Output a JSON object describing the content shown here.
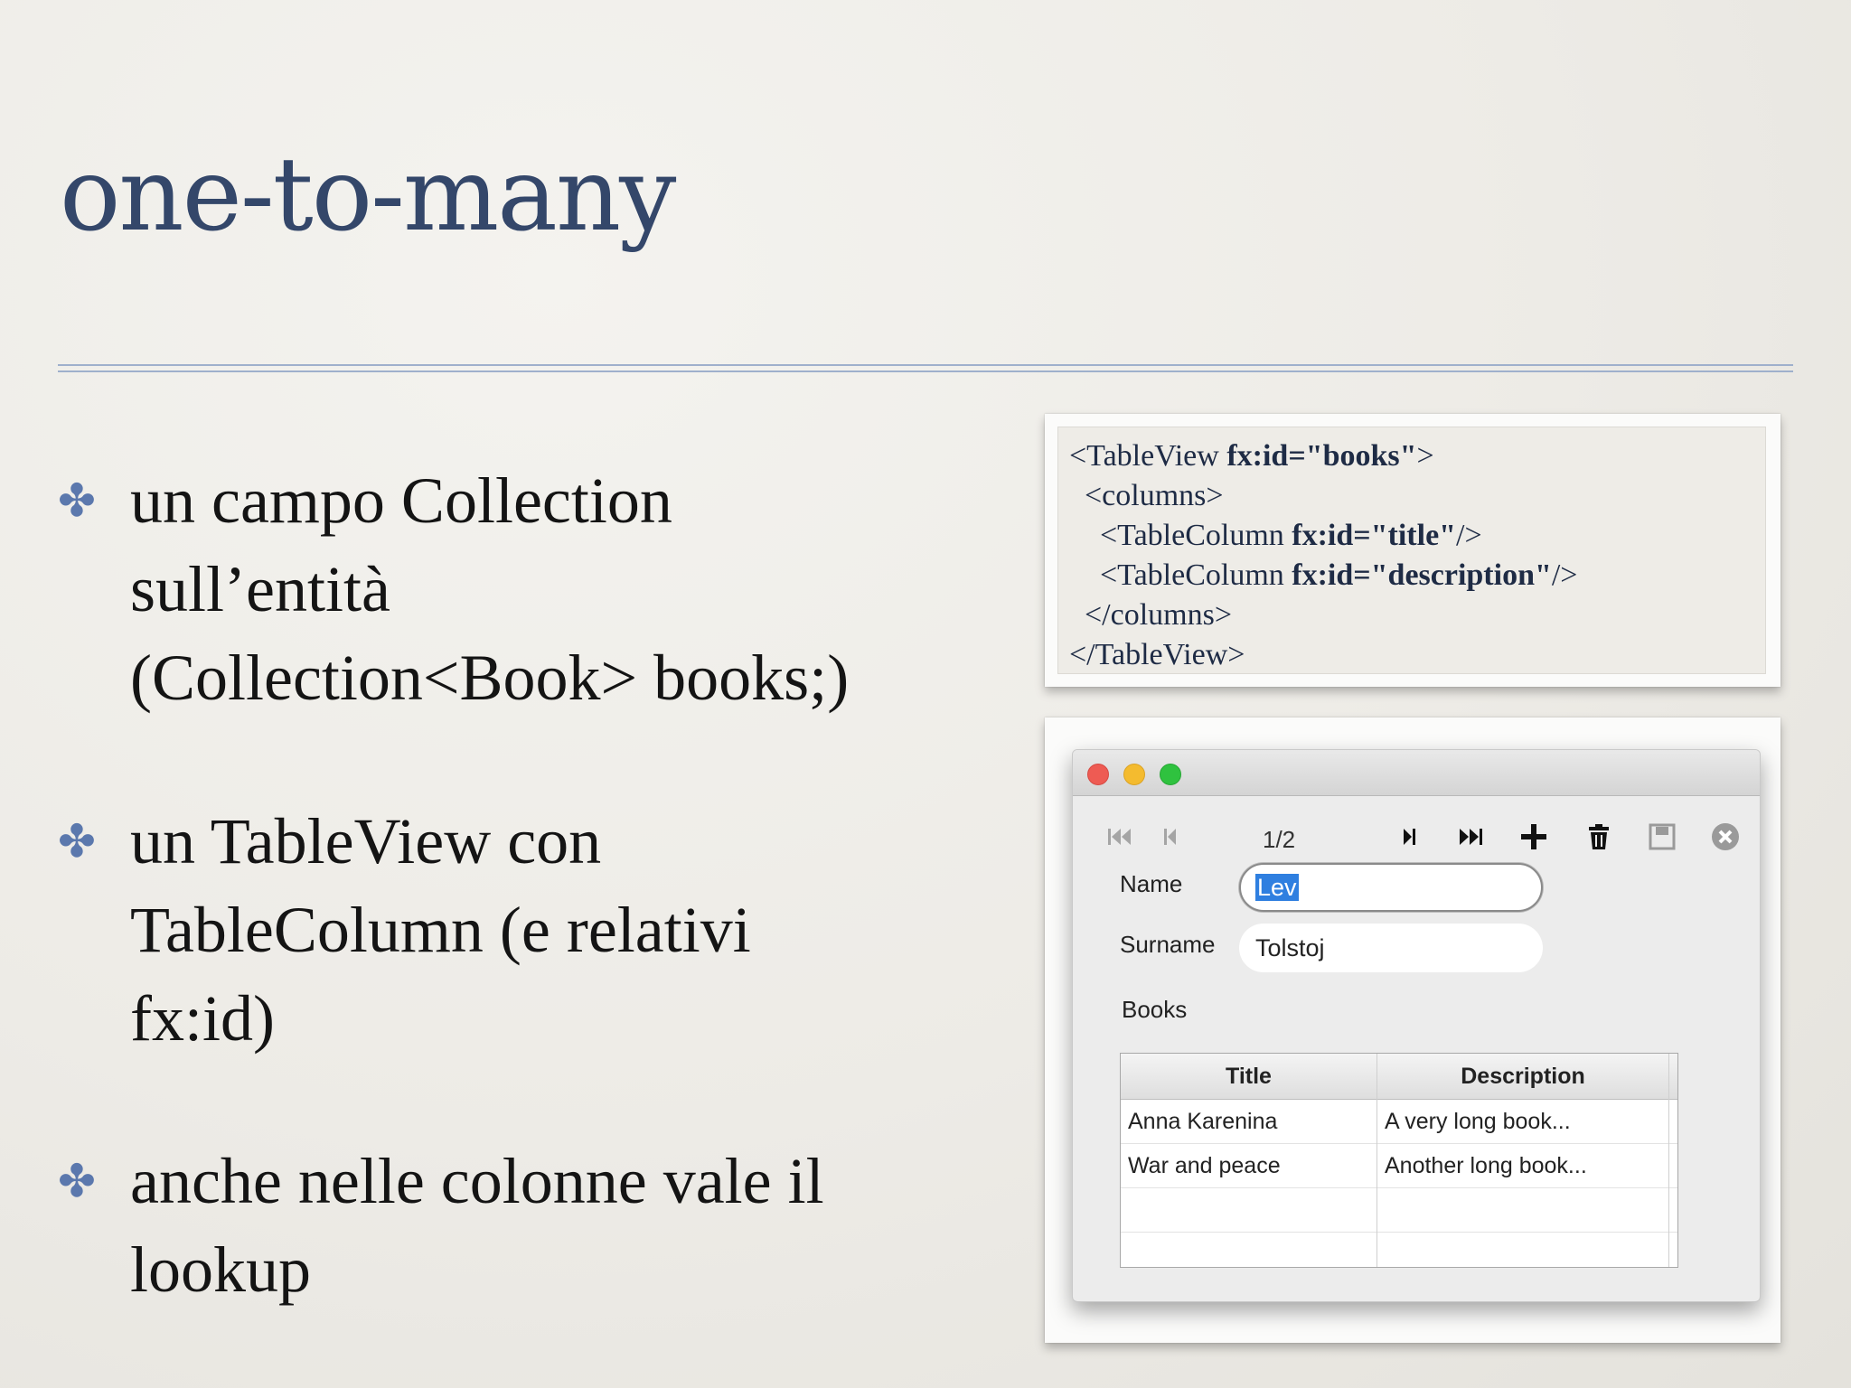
{
  "slide": {
    "title": "one-to-many",
    "bullets": [
      {
        "lines": [
          "un campo Collection",
          "sull’entità",
          "(Collection<Book> books;)"
        ]
      },
      {
        "lines": [
          "un TableView con",
          "TableColumn (e relativi",
          "fx:id)"
        ]
      },
      {
        "lines": [
          "anche nelle colonne vale il",
          "lookup"
        ]
      }
    ],
    "bullet_symbol": "✤"
  },
  "code": {
    "lines": [
      {
        "indent": "",
        "pre": "<TableView ",
        "bold": "fx:id=\"books\"",
        "post": ">"
      },
      {
        "indent": "  ",
        "pre": "<columns>",
        "bold": "",
        "post": ""
      },
      {
        "indent": "    ",
        "pre": "<TableColumn ",
        "bold": "fx:id=\"title\"",
        "post": "/>"
      },
      {
        "indent": "    ",
        "pre": "<TableColumn ",
        "bold": "fx:id=\"description\"",
        "post": "/>"
      },
      {
        "indent": "  ",
        "pre": "</columns>",
        "bold": "",
        "post": ""
      },
      {
        "indent": "",
        "pre": "</TableView>",
        "bold": "",
        "post": ""
      }
    ]
  },
  "app": {
    "toolbar": {
      "page_indicator": "1/2",
      "icons": [
        "first-icon",
        "previous-icon",
        "next-icon",
        "last-icon",
        "add-icon",
        "delete-icon",
        "save-icon",
        "close-circle-icon"
      ]
    },
    "form": {
      "name_label": "Name",
      "name_value": "Lev",
      "surname_label": "Surname",
      "surname_value": "Tolstoj",
      "books_label": "Books"
    },
    "table": {
      "columns": [
        "Title",
        "Description"
      ],
      "rows": [
        [
          "Anna Karenina",
          "A very long book..."
        ],
        [
          "War and peace",
          "Another long book..."
        ]
      ]
    },
    "colors": {
      "close": "#ee5b53",
      "minimize": "#f4bb2f",
      "zoom": "#2fc23f",
      "selection": "#2f7fe0"
    }
  }
}
